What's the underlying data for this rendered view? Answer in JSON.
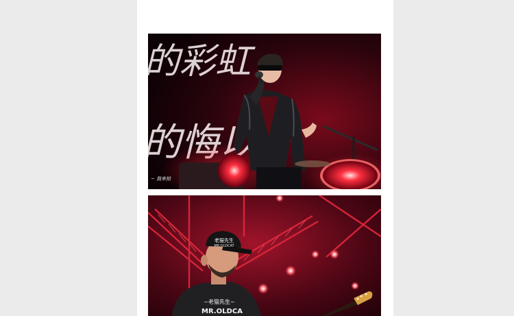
{
  "article": {
    "photos": [
      {
        "name": "singer-on-stage-photo",
        "backdrop_text": [
          "的彩虹",
          "的悔以"
        ],
        "signature": "~ 我来拍"
      },
      {
        "name": "guitarist-on-stage-photo",
        "cap_text": "老猫先生",
        "cap_subtext": "MR.OLDCAT",
        "shirt_text": "~老猫先生~",
        "shirt_subtext": "MR.OLDCA"
      }
    ]
  },
  "colors": {
    "page_background": "#ebebeb",
    "content_background": "#ffffff",
    "stage_red": "#e0102a",
    "stage_dark": "#1a0208"
  }
}
